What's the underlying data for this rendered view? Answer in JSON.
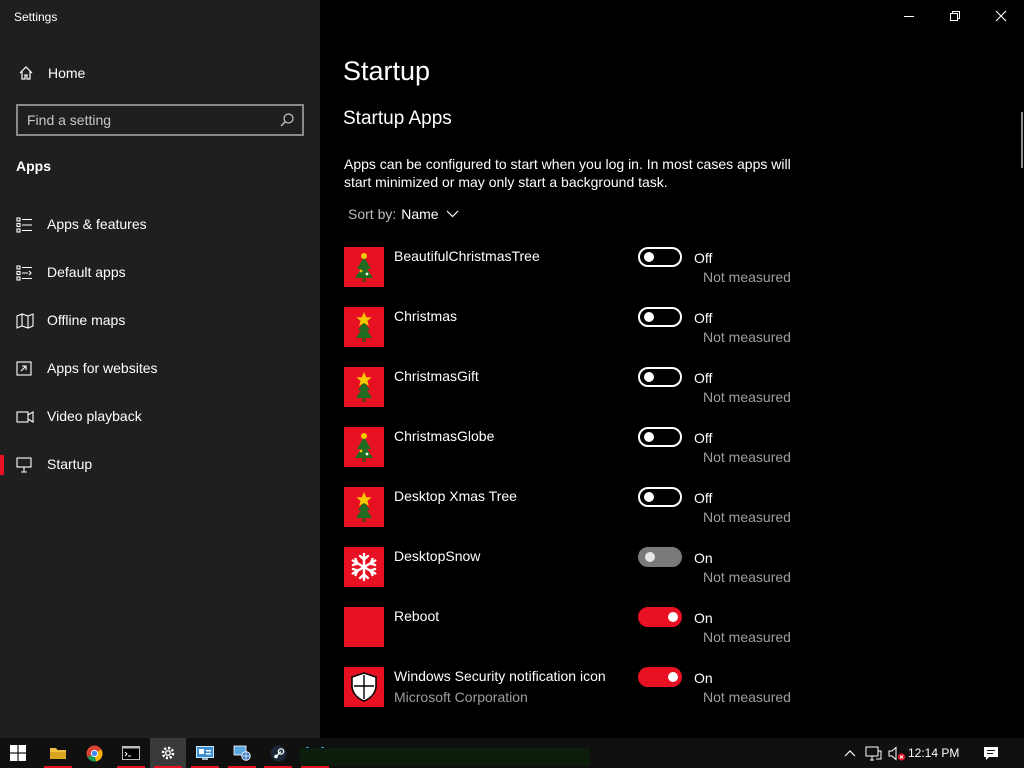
{
  "window": {
    "title": "Settings"
  },
  "sidebar": {
    "home_label": "Home",
    "search_placeholder": "Find a setting",
    "section": "Apps",
    "items": [
      {
        "label": "Apps & features",
        "icon": "apps-features-icon",
        "active": false
      },
      {
        "label": "Default apps",
        "icon": "default-apps-icon",
        "active": false
      },
      {
        "label": "Offline maps",
        "icon": "offline-maps-icon",
        "active": false
      },
      {
        "label": "Apps for websites",
        "icon": "apps-for-websites-icon",
        "active": false
      },
      {
        "label": "Video playback",
        "icon": "video-playback-icon",
        "active": false
      },
      {
        "label": "Startup",
        "icon": "startup-icon",
        "active": true
      }
    ]
  },
  "main": {
    "title": "Startup",
    "subtitle": "Startup Apps",
    "description": "Apps can be configured to start when you log in. In most cases apps will start minimized or may only start a background task.",
    "sort_label": "Sort by:",
    "sort_value": "Name",
    "apps": [
      {
        "name": "BeautifulChristmasTree",
        "publisher": "",
        "state": "Off",
        "impact": "Not measured",
        "icon": "christmas-tree-icon"
      },
      {
        "name": "Christmas",
        "publisher": "",
        "state": "Off",
        "impact": "Not measured",
        "icon": "star-tree-icon"
      },
      {
        "name": "ChristmasGift",
        "publisher": "",
        "state": "Off",
        "impact": "Not measured",
        "icon": "star-tree-icon"
      },
      {
        "name": "ChristmasGlobe",
        "publisher": "",
        "state": "Off",
        "impact": "Not measured",
        "icon": "christmas-tree-icon"
      },
      {
        "name": "Desktop Xmas Tree",
        "publisher": "",
        "state": "Off",
        "impact": "Not measured",
        "icon": "star-tree-icon"
      },
      {
        "name": "DesktopSnow",
        "publisher": "",
        "state": "On",
        "impact": "Not measured",
        "icon": "snowflake-icon"
      },
      {
        "name": "Reboot",
        "publisher": "",
        "state": "On",
        "impact": "Not measured",
        "icon": "blank-app-icon"
      },
      {
        "name": "Windows Security notification icon",
        "publisher": "Microsoft Corporation",
        "state": "On",
        "impact": "Not measured",
        "icon": "shield-icon"
      }
    ]
  },
  "taskbar": {
    "clock": "12:14 PM",
    "apps": [
      "start-icon",
      "file-explorer-icon",
      "chrome-icon",
      "command-prompt-icon",
      "settings-icon",
      "control-panel-icon",
      "network-icon",
      "steam-icon",
      "app-icon"
    ]
  },
  "colors": {
    "accent": "#e81123",
    "sidebar_bg": "#1f1f1f",
    "main_bg": "#000000"
  }
}
